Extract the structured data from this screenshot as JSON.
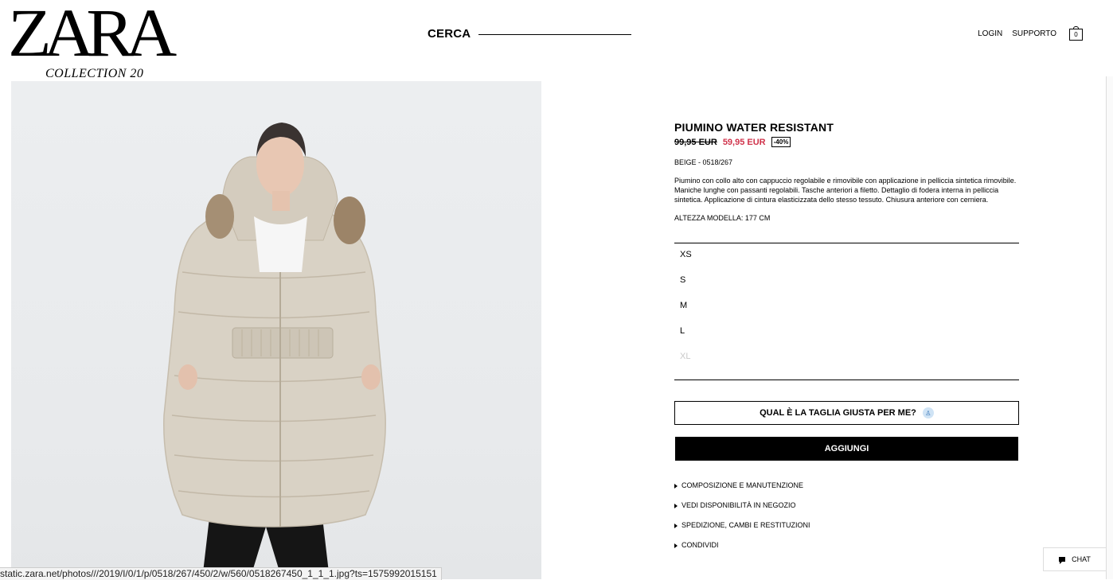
{
  "brand": {
    "logo_text": "ZARA",
    "logo_sub": "COLLECTION 20"
  },
  "header": {
    "search_label": "CERCA",
    "login": "LOGIN",
    "support": "SUPPORTO",
    "cart_count": "0"
  },
  "product": {
    "title": "PIUMINO WATER RESISTANT",
    "price_old": "99,95 EUR",
    "price_new": "59,95 EUR",
    "discount": "-40%",
    "color_ref": "BEIGE - 0518/267",
    "description": "Piumino con collo alto con cappuccio regolabile e rimovibile con applicazione in pelliccia sintetica rimovibile. Maniche lunghe con passanti regolabili. Tasche anteriori a filetto. Dettaglio di fodera interna in pelliccia sintetica. Applicazione di cintura elasticizzata dello stesso tessuto. Chiusura anteriore con cerniera.",
    "model_height": "ALTEZZA MODELLA: 177 CM",
    "sizes": [
      {
        "label": "XS",
        "available": true
      },
      {
        "label": "S",
        "available": true
      },
      {
        "label": "M",
        "available": true
      },
      {
        "label": "L",
        "available": true
      },
      {
        "label": "XL",
        "available": false
      }
    ],
    "size_guide_button": "QUAL È LA TAGLIA GIUSTA PER ME?",
    "add_button": "AGGIUNGI",
    "accordions": [
      "COMPOSIZIONE E MANUTENZIONE",
      "VEDI DISPONIBILITÀ IN NEGOZIO",
      "SPEDIZIONE, CAMBI E RESTITUZIONI",
      "CONDIVIDI"
    ]
  },
  "chat": {
    "label": "CHAT"
  },
  "status_bar": {
    "url": "static.zara.net/photos///2019/I/0/1/p/0518/267/450/2/w/560/0518267450_1_1_1.jpg?ts=1575992015151"
  },
  "colors": {
    "sale_red": "#d0334b",
    "coat_beige": "#d9d2c5",
    "image_bg": "#eceef0"
  }
}
